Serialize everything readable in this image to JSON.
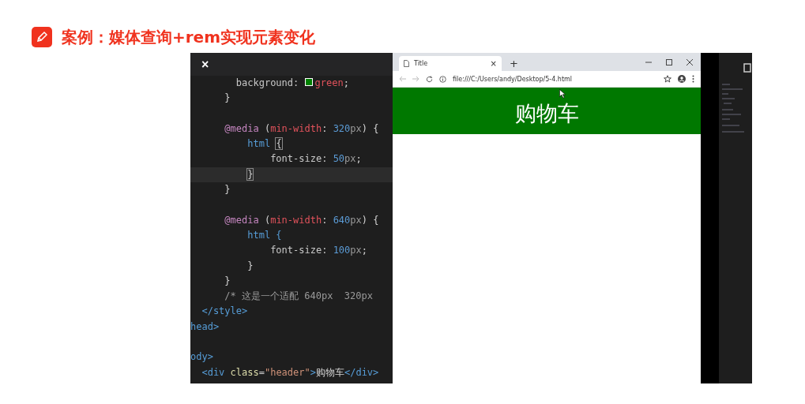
{
  "slide_title": "案例：媒体查询+rem实现元素变化",
  "editor": {
    "tab_close": "×",
    "lines": [
      {
        "current": false,
        "tokens": [
          {
            "kind": "prop",
            "text": "        background: "
          },
          {
            "kind": "swatch",
            "color": "#008000"
          },
          {
            "kind": "value",
            "text": "green"
          },
          {
            "kind": "plain",
            "text": ";"
          }
        ]
      },
      {
        "current": false,
        "tokens": [
          {
            "kind": "plain",
            "text": "      }"
          }
        ]
      },
      {
        "current": false
      },
      {
        "current": false,
        "tokens": [
          {
            "kind": "keyword",
            "text": "      @media"
          },
          {
            "kind": "plain",
            "text": " ("
          },
          {
            "kind": "value",
            "text": "min-width"
          },
          {
            "kind": "plain",
            "text": ": "
          },
          {
            "kind": "number",
            "text": "320"
          },
          {
            "kind": "unit",
            "text": "px"
          },
          {
            "kind": "plain",
            "text": ") {"
          }
        ]
      },
      {
        "current": false,
        "tokens": [
          {
            "kind": "tag",
            "text": "          html "
          },
          {
            "kind": "match",
            "text": "{"
          }
        ]
      },
      {
        "current": false,
        "tokens": [
          {
            "kind": "prop",
            "text": "              font-size: "
          },
          {
            "kind": "number",
            "text": "50"
          },
          {
            "kind": "unit",
            "text": "px"
          },
          {
            "kind": "plain",
            "text": ";"
          }
        ]
      },
      {
        "current": true,
        "tokens": [
          {
            "kind": "match",
            "text": "          }"
          }
        ]
      },
      {
        "current": false,
        "tokens": [
          {
            "kind": "plain",
            "text": "      }"
          }
        ]
      },
      {
        "current": false
      },
      {
        "current": false,
        "tokens": [
          {
            "kind": "keyword",
            "text": "      @media"
          },
          {
            "kind": "plain",
            "text": " ("
          },
          {
            "kind": "value",
            "text": "min-width"
          },
          {
            "kind": "plain",
            "text": ": "
          },
          {
            "kind": "number",
            "text": "640"
          },
          {
            "kind": "unit",
            "text": "px"
          },
          {
            "kind": "plain",
            "text": ") {"
          }
        ]
      },
      {
        "current": false,
        "tokens": [
          {
            "kind": "tag",
            "text": "          html {"
          }
        ]
      },
      {
        "current": false,
        "tokens": [
          {
            "kind": "prop",
            "text": "              font-size: "
          },
          {
            "kind": "number",
            "text": "100"
          },
          {
            "kind": "unit",
            "text": "px"
          },
          {
            "kind": "plain",
            "text": ";"
          }
        ]
      },
      {
        "current": false,
        "tokens": [
          {
            "kind": "plain",
            "text": "          }"
          }
        ]
      },
      {
        "current": false,
        "tokens": [
          {
            "kind": "plain",
            "text": "      }"
          }
        ]
      },
      {
        "current": false,
        "tokens": [
          {
            "kind": "comment",
            "text": "      /* 这是一个适配 640px  320px"
          }
        ]
      },
      {
        "current": false,
        "tokens": [
          {
            "kind": "tag",
            "text": "  </style>"
          }
        ]
      },
      {
        "current": false,
        "tokens": [
          {
            "kind": "tag",
            "text": "head>"
          }
        ]
      },
      {
        "current": false
      },
      {
        "current": false,
        "tokens": [
          {
            "kind": "tag",
            "text": "ody>"
          }
        ]
      },
      {
        "current": false,
        "tokens": [
          {
            "kind": "tag",
            "text": "  <div "
          },
          {
            "kind": "attr",
            "text": "class"
          },
          {
            "kind": "plain",
            "text": "="
          },
          {
            "kind": "string",
            "text": "\"header\""
          },
          {
            "kind": "tag",
            "text": ">"
          },
          {
            "kind": "plain",
            "text": "购物车"
          },
          {
            "kind": "tag",
            "text": "</div>"
          }
        ]
      }
    ]
  },
  "browser": {
    "tab": {
      "title": "Title",
      "close": "×"
    },
    "new_tab": "+",
    "url": "file:///C:/Users/andy/Desktop/5-4.html",
    "header_text": "购物车"
  }
}
